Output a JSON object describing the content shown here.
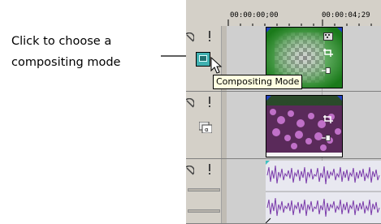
{
  "callout": {
    "line1": "Click to choose a",
    "line2": "compositing mode"
  },
  "tooltip": {
    "text": "Compositing Mode"
  },
  "ruler": {
    "start": "00:00:00;00",
    "end": "00:00:04;29"
  },
  "colors": {
    "green_event": "#2a8a2a",
    "purple_event": "#8a4a9a",
    "audio_wave": "#7a3aaa",
    "tooltip_bg": "#ffffe1"
  },
  "icons": {
    "mute": "mute-icon",
    "solo": "solo-icon",
    "compositing": "compositing-mode-icon",
    "cursor": "mouse-pointer-icon",
    "pan_crop": "pan-crop-icon",
    "fx": "event-fx-icon",
    "mask": "mask-icon"
  }
}
